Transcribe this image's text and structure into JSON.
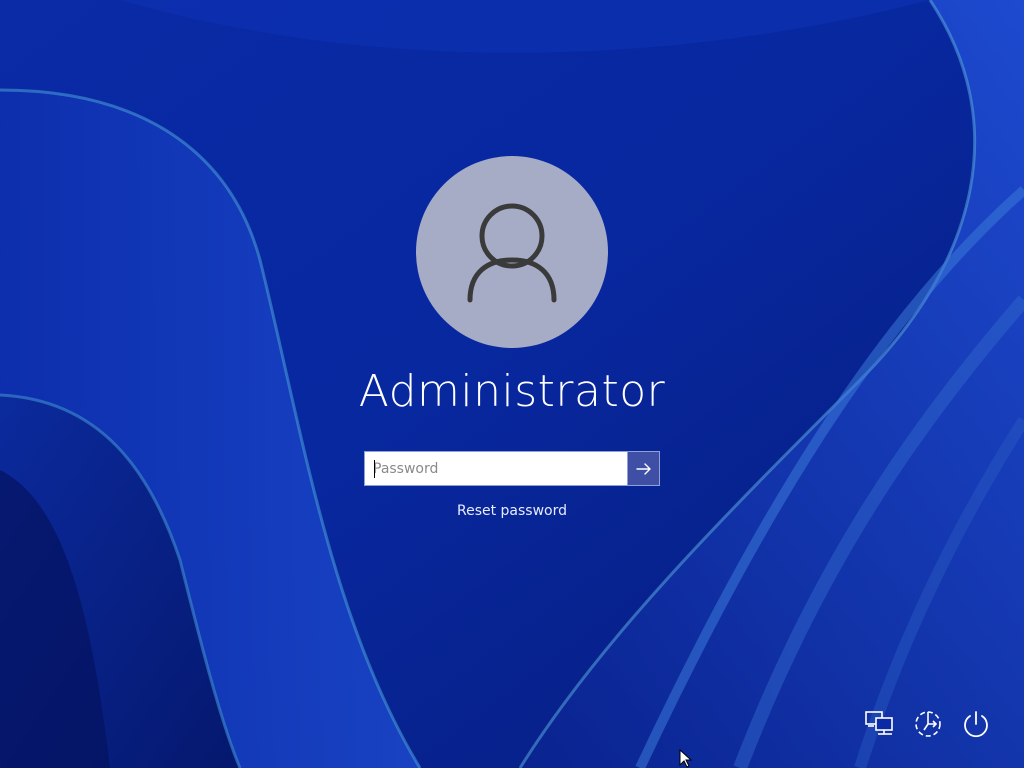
{
  "user": {
    "name": "Administrator"
  },
  "password_field": {
    "value": "",
    "placeholder": "Password"
  },
  "links": {
    "reset_password": "Reset password"
  },
  "icons": {
    "avatar": "user-icon",
    "submit": "arrow-right-icon",
    "network": "network-icon",
    "accessibility": "accessibility-icon",
    "power": "power-icon"
  },
  "colors": {
    "background": "#0b2fa8",
    "avatar_bg": "#a6acc6",
    "submit_bg": "#3f4fa6",
    "text": "#ffffff"
  }
}
